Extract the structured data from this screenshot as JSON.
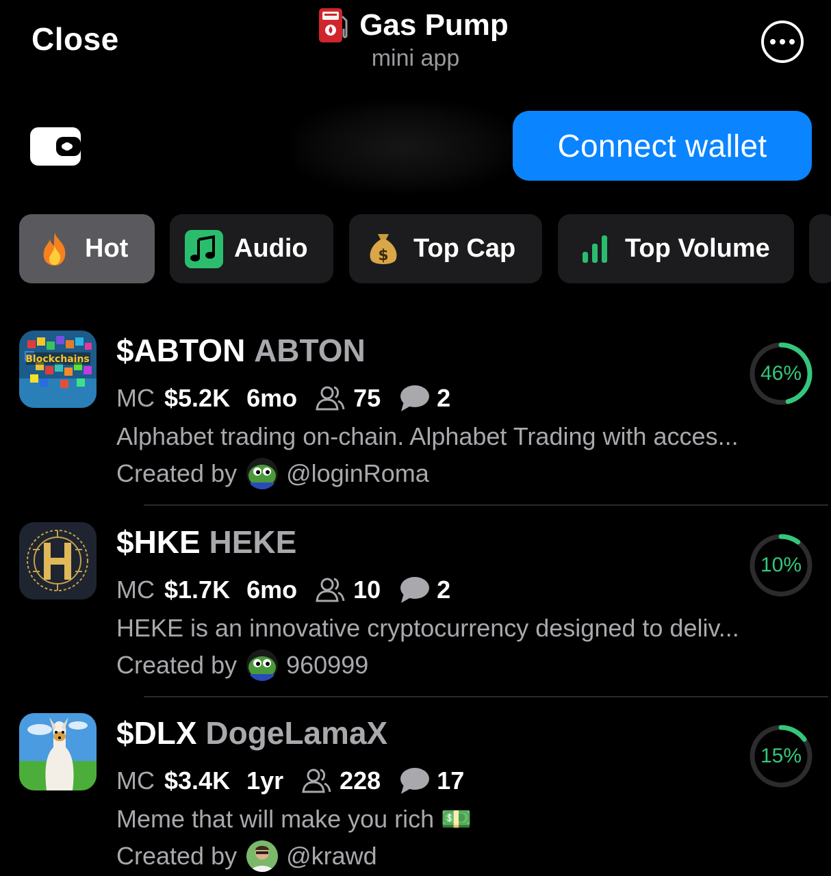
{
  "header": {
    "close_label": "Close",
    "title": "Gas Pump",
    "subtitle": "mini app",
    "title_icon": "fuel-pump-icon",
    "more_icon": "more-ellipsis-icon"
  },
  "wallet": {
    "icon": "wallet-icon",
    "connect_label": "Connect wallet"
  },
  "tabs": [
    {
      "label": "Hot",
      "icon": "fire-icon",
      "active": true
    },
    {
      "label": "Audio",
      "icon": "music-note-icon",
      "active": false
    },
    {
      "label": "Top Cap",
      "icon": "money-bag-icon",
      "active": false
    },
    {
      "label": "Top Volume",
      "icon": "bar-chart-icon",
      "active": false
    }
  ],
  "tokens": [
    {
      "symbol": "$ABTON",
      "name": "ABTON",
      "mc_label": "MC",
      "mc": "$5.2K",
      "age": "6mo",
      "holders": "75",
      "comments": "2",
      "description": "Alphabet trading on-chain. Alphabet Trading with acces...",
      "created_by_label": "Created by",
      "creator": "@loginRoma",
      "progress": "46%",
      "progress_value": 0.46
    },
    {
      "symbol": "$HKE",
      "name": "HEKE",
      "mc_label": "MC",
      "mc": "$1.7K",
      "age": "6mo",
      "holders": "10",
      "comments": "2",
      "description": "HEKE is an innovative cryptocurrency designed to deliv...",
      "created_by_label": "Created by",
      "creator": "960999",
      "progress": "10%",
      "progress_value": 0.1
    },
    {
      "symbol": "$DLX",
      "name": "DogeLamaX",
      "mc_label": "MC",
      "mc": "$3.4K",
      "age": "1yr",
      "holders": "228",
      "comments": "17",
      "description": "Meme that will make you rich 💵",
      "created_by_label": "Created by",
      "creator": "@krawd",
      "progress": "15%",
      "progress_value": 0.15
    }
  ],
  "colors": {
    "accent": "#0a84ff",
    "progress": "#34c77b",
    "ring_track": "#2c2c2e",
    "muted_text": "#a9a9ad"
  }
}
